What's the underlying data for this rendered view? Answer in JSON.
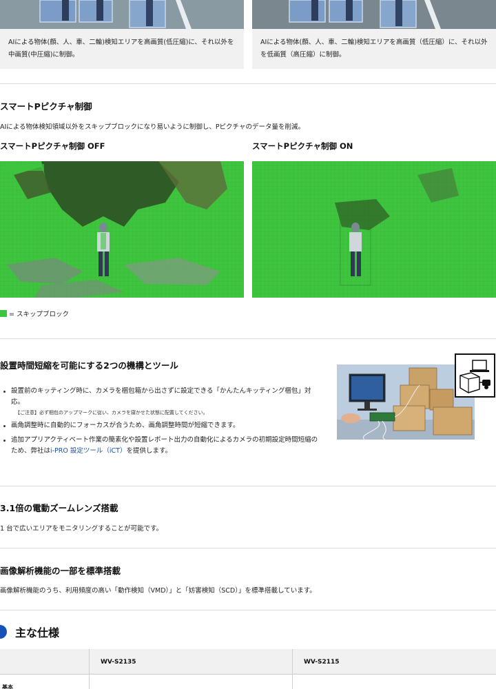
{
  "cards": [
    {
      "text": "AIによる物体(顔、人、車、二輪)検知エリアを高画質(低圧縮)に、それ以外を中画質(中圧縮)に制御。"
    },
    {
      "text": "AIによる物体(顔、人、車、二輪)検知エリアを高画質（低圧縮）に、それ以外を低画質（高圧縮）に制御。"
    }
  ],
  "smart_p": {
    "heading": "スマートPピクチャ制御",
    "description": "AIによる物体検知領域以外をスキップブロックになり易いように制御し、Pピクチャのデータ量を削減。",
    "off_label": "スマートPピクチャ制御 OFF",
    "on_label": "スマートPピクチャ制御 ON",
    "legend": "= スキップブロック",
    "skip_color": "#3ec43e"
  },
  "install": {
    "heading": "設置時間短縮を可能にする2つの機構とツール",
    "items": [
      {
        "text": "設置前のキッティング時に、カメラを梱包箱から出さずに設定できる「かんたんキッティング梱包」対応。",
        "note": "【ご注意】必ず梱包のアップマークに従い、カメラを寝かせた状態に配置してください。"
      },
      {
        "text": "画角調整時に自動的にフォーカスが合うため、画角調整時間が短縮できます。"
      },
      {
        "text_before": "追加アプリアクティベート作業の簡素化や設置レポート出力の自動化によるカメラの初期設定時間短縮のため、弊社は",
        "link": "i-PRO 設定ツール（iCT）",
        "text_after": "を提供します。"
      }
    ],
    "link_color": "#1a4fa0"
  },
  "zoom": {
    "heading": "3.1倍の電動ズームレンズ搭載",
    "description": "1 台で広いエリアをモニタリングすることが可能です。"
  },
  "analytics": {
    "heading": "画像解析機能の一部を標準搭載",
    "description": "画像解析機能のうち、利用頻度の高い「動作検知（VMD）」と「妨害検知（SCD）」を標準搭載しています。"
  },
  "specs": {
    "heading": "主な仕様",
    "accent_color": "#1452b8",
    "columns": [
      "WV-S2135",
      "WV-S2115"
    ],
    "row_label": "基本"
  }
}
